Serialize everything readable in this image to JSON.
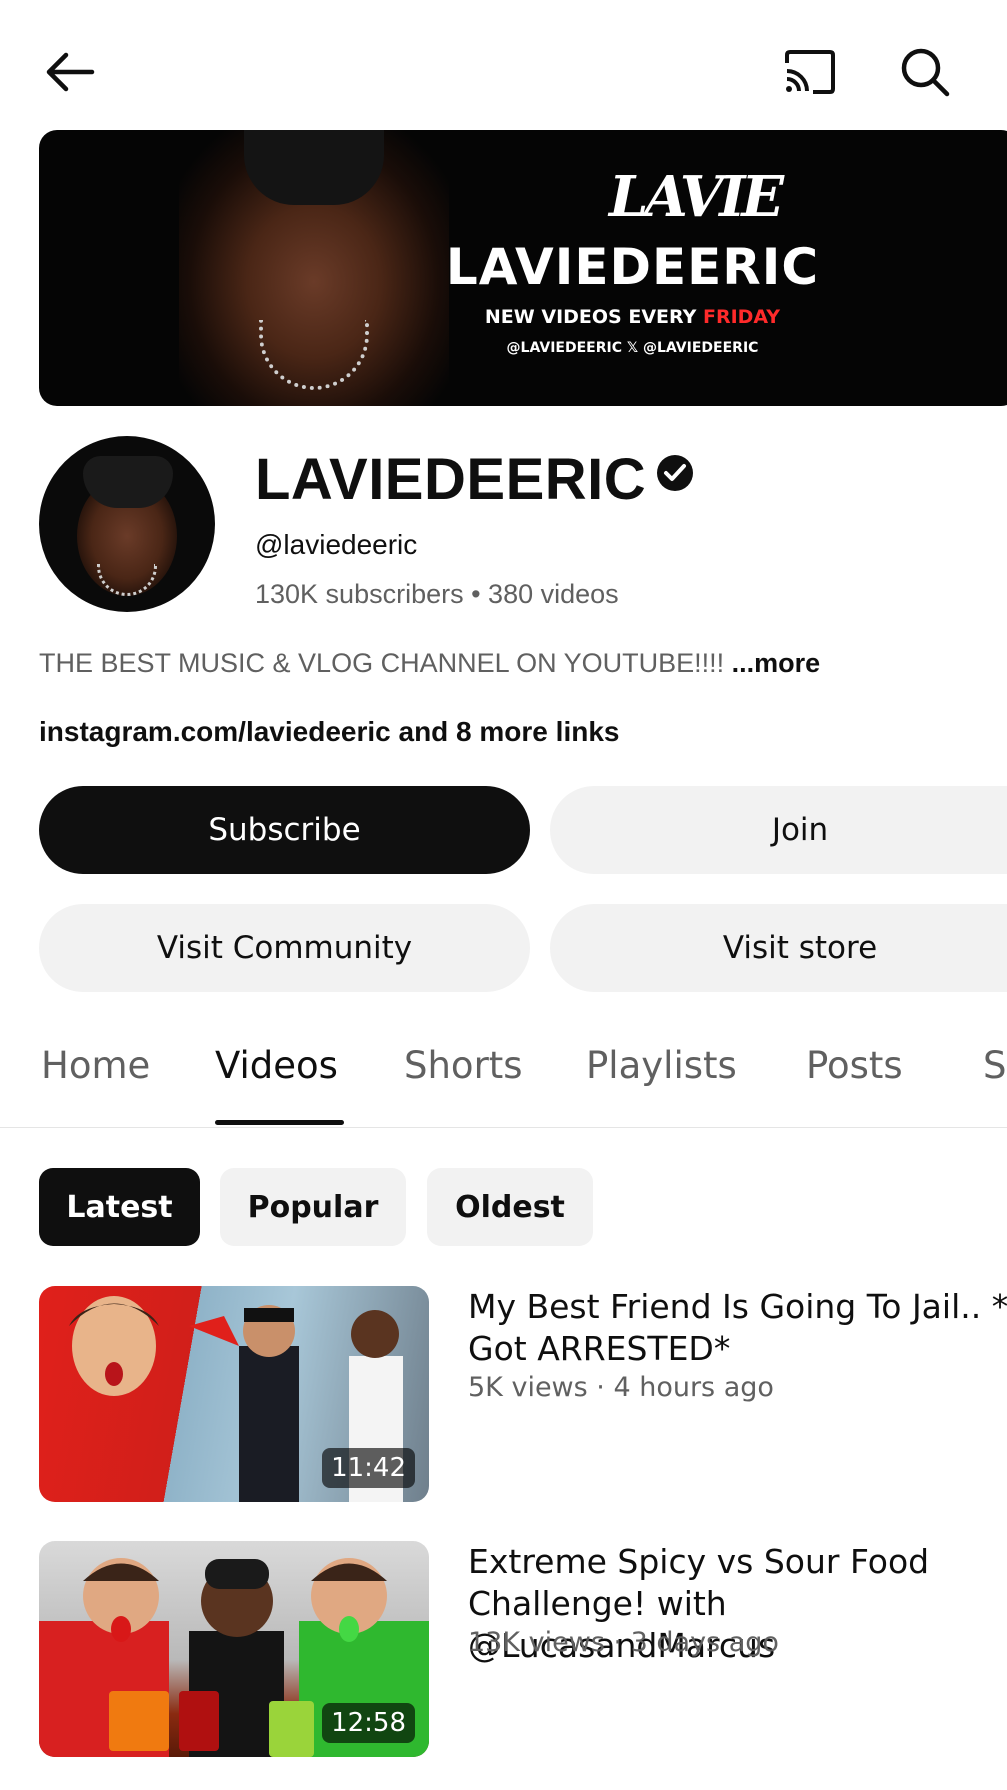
{
  "header": {
    "back_icon": "back-arrow-icon",
    "cast_icon": "cast-icon",
    "search_icon": "search-icon"
  },
  "banner": {
    "logo_text": "LAVIE",
    "title": "LAVIEDEERIC",
    "tagline_prefix": "NEW VIDEOS EVERY ",
    "tagline_highlight": "FRIDAY",
    "handles": "@LAVIEDEERIC  𝕏 @LAVIEDEERIC"
  },
  "channel": {
    "name": "LAVIEDEERIC",
    "handle": "@laviedeeric",
    "stats": "130K subscribers • 380 videos",
    "description": "THE BEST MUSIC & VLOG CHANNEL ON YOUTUBE!!!! ",
    "description_more": "...more",
    "links": "instagram.com/laviedeeric and 8 more links"
  },
  "buttons": {
    "subscribe": "Subscribe",
    "join": "Join",
    "community": "Visit Community",
    "store": "Visit store"
  },
  "tabs": [
    {
      "label": "Home"
    },
    {
      "label": "Videos"
    },
    {
      "label": "Shorts"
    },
    {
      "label": "Playlists"
    },
    {
      "label": "Posts"
    },
    {
      "label": "S"
    }
  ],
  "active_tab": "Videos",
  "chips": [
    {
      "label": "Latest"
    },
    {
      "label": "Popular"
    },
    {
      "label": "Oldest"
    }
  ],
  "videos": [
    {
      "title": "My Best Friend Is Going To Jail.. *I Got ARRESTED*",
      "meta": "5K views · 4 hours ago",
      "duration": "11:42"
    },
    {
      "title": "Extreme Spicy vs Sour Food Challenge! with @LucasandMarcus",
      "meta": "13K views · 3 days ago",
      "duration": "12:58"
    }
  ],
  "colors": {
    "accent_red": "#ff2a2a",
    "text_primary": "#0f0f0f",
    "text_secondary": "#606060",
    "chip_bg": "#f2f2f2"
  }
}
